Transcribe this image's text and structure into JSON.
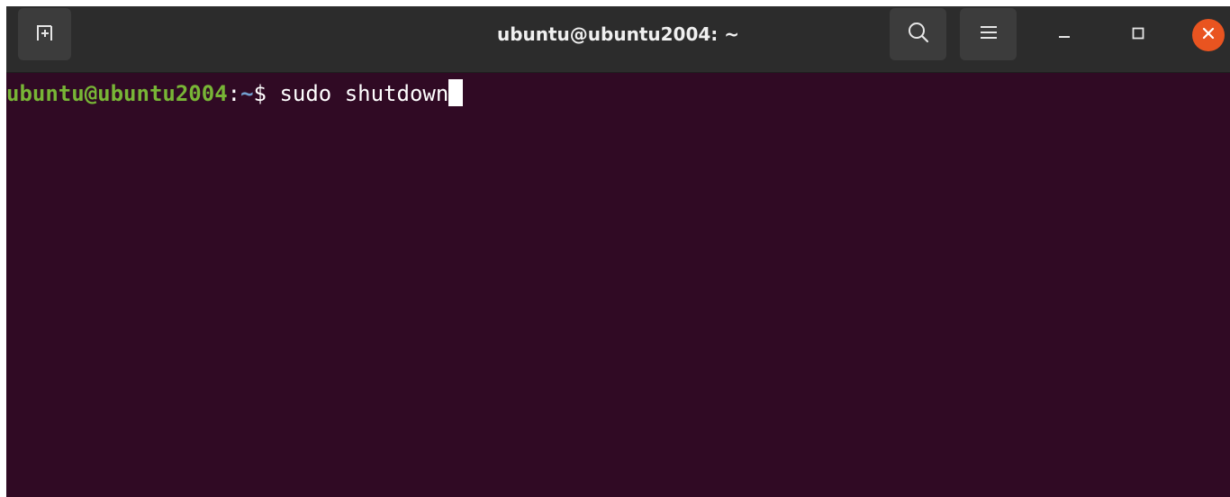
{
  "window": {
    "title": "ubuntu@ubuntu2004: ~"
  },
  "header": {
    "new_tab_icon": "new-tab-icon",
    "search_icon": "search-icon",
    "menu_icon": "hamburger-menu-icon",
    "minimize_icon": "minimize-icon",
    "maximize_icon": "maximize-icon",
    "close_icon": "close-icon"
  },
  "terminal": {
    "prompt_user_host": "ubuntu@ubuntu2004",
    "prompt_separator": ":",
    "prompt_path": "~",
    "prompt_symbol": "$",
    "command": " sudo shutdown"
  },
  "colors": {
    "terminal_background": "#300a24",
    "titlebar_background": "#2c2c2c",
    "header_button_background": "#3c3c3c",
    "prompt_user_color": "#78b536",
    "prompt_path_color": "#729fcf",
    "close_button_color": "#e95420",
    "text_color": "#ffffff"
  }
}
